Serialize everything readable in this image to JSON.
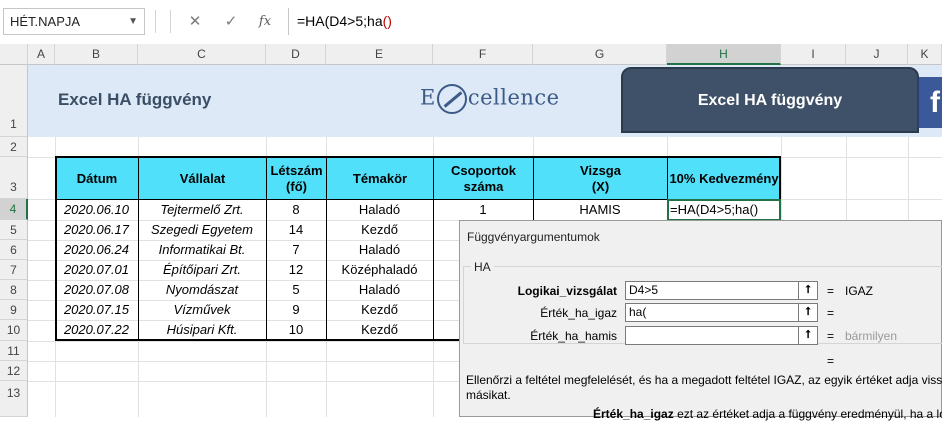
{
  "formula_bar": {
    "name_box": "HÉT.NAPJA",
    "cancel_glyph": "✕",
    "enter_glyph": "✓",
    "fx_label": "fx",
    "formula_main": "=HA(D4>5;ha",
    "formula_paren": "()"
  },
  "columns": [
    "A",
    "B",
    "C",
    "D",
    "E",
    "F",
    "G",
    "H",
    "I",
    "J",
    "K"
  ],
  "rows": [
    "1",
    "2",
    "3",
    "4",
    "5",
    "6",
    "7",
    "8",
    "9",
    "10",
    "11",
    "12",
    "13"
  ],
  "banner": {
    "title": "Excel HA függvény",
    "logo_left": "E",
    "logo_right": "cellence",
    "nav_button": "Excel HA függvény",
    "facebook_glyph": "f"
  },
  "table": {
    "headers": [
      "Dátum",
      "Vállalat",
      "Létszám\n(fő)",
      "Témakör",
      "Csoportok\nszáma",
      "Vizsga\n(X)",
      "10% Kedvezmény"
    ],
    "rows": [
      [
        "2020.06.10",
        "Tejtermelő Zrt.",
        "8",
        "Haladó",
        "1",
        "HAMIS",
        "=HA(D4>5;ha()"
      ],
      [
        "2020.06.17",
        "Szegedi Egyetem",
        "14",
        "Kezdő",
        "",
        "",
        ""
      ],
      [
        "2020.06.24",
        "Informatikai Bt.",
        "7",
        "Haladó",
        "",
        "",
        ""
      ],
      [
        "2020.07.01",
        "Építőipari Zrt.",
        "12",
        "Középhaladó",
        "",
        "",
        ""
      ],
      [
        "2020.07.08",
        "Nyomdászat",
        "5",
        "Haladó",
        "",
        "",
        ""
      ],
      [
        "2020.07.15",
        "Vízművek",
        "9",
        "Kezdő",
        "",
        "",
        ""
      ],
      [
        "2020.07.22",
        "Húsipari Kft.",
        "10",
        "Kezdő",
        "",
        "",
        ""
      ]
    ]
  },
  "dialog": {
    "title": "Függvényargumentumok",
    "group": "HA",
    "args": [
      {
        "label": "Logikai_vizsgálat",
        "value": "D4>5",
        "result": "IGAZ",
        "bold": true
      },
      {
        "label": "Érték_ha_igaz",
        "value": "ha(",
        "result": "",
        "bold": false
      },
      {
        "label": "Érték_ha_hamis",
        "value": "",
        "result": "bármilyen",
        "bold": false
      }
    ],
    "collapse_glyph": "⭡",
    "equals": "=",
    "description": "Ellenőrzi a feltétel megfelelését, és ha a megadott feltétel IGAZ, az egyik értéket adja vissza, ha",
    "description_cont": "másikat.",
    "arg_desc_name": "Érték_ha_igaz",
    "arg_desc_text": "ezt az értéket adja a függvény eredményül, ha a logiki"
  }
}
